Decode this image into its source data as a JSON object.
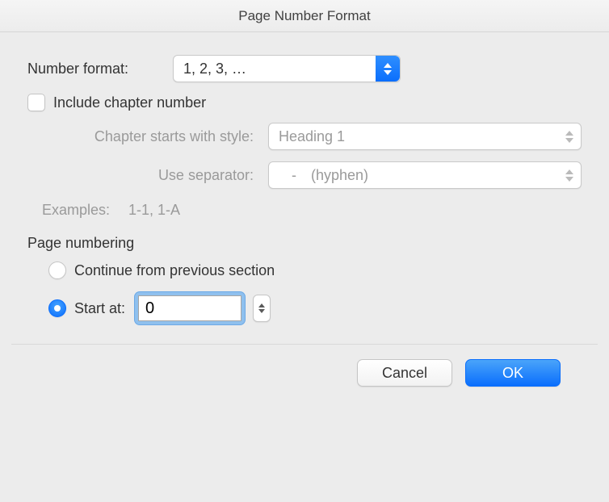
{
  "title": "Page Number Format",
  "numberFormat": {
    "label": "Number format:",
    "value": "1, 2, 3, …"
  },
  "includeChapter": {
    "label": "Include chapter number"
  },
  "chapterStyle": {
    "label": "Chapter starts with style:",
    "value": "Heading 1"
  },
  "separator": {
    "label": "Use separator:",
    "value": "- (hyphen)"
  },
  "examples": "Examples:  1-1, 1-A",
  "numberingTitle": "Page numbering",
  "continueLabel": "Continue from previous section",
  "startAt": {
    "label": "Start at:",
    "value": "0"
  },
  "buttons": {
    "cancel": "Cancel",
    "ok": "OK"
  }
}
